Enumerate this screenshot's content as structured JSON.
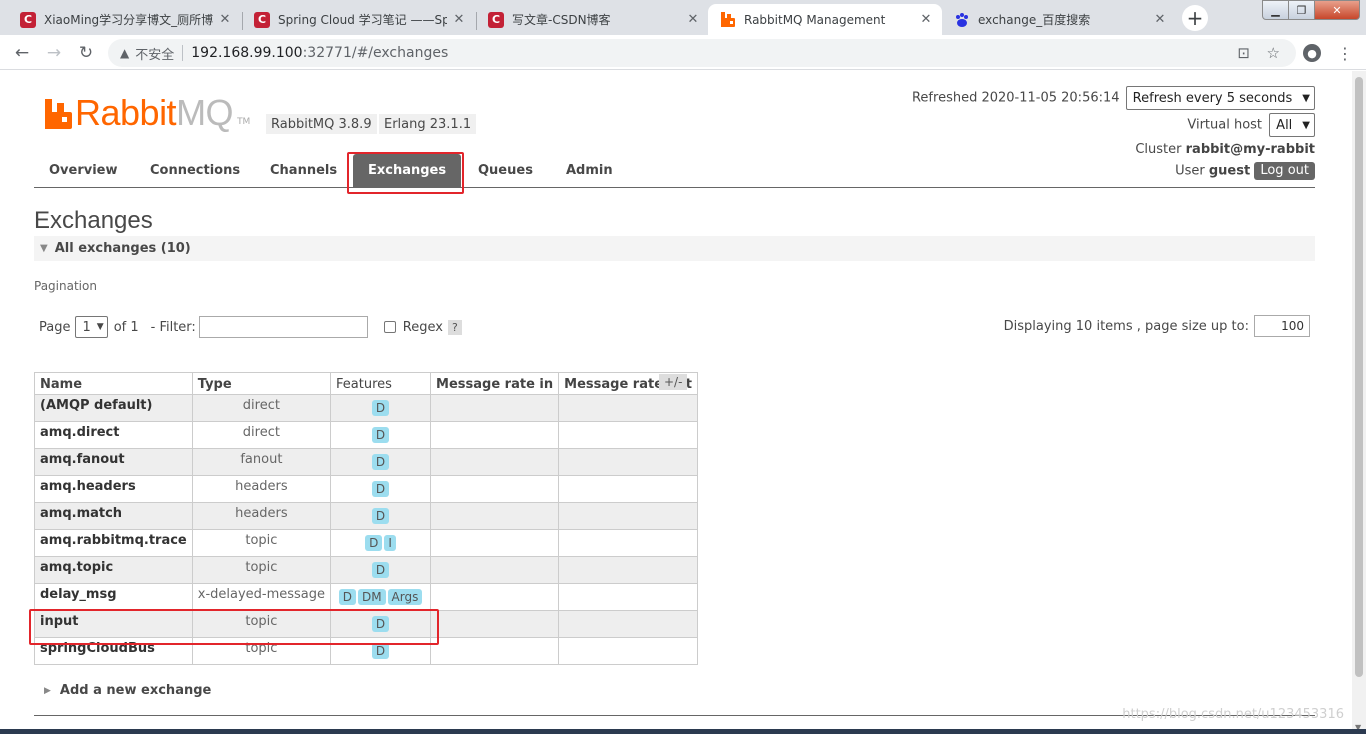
{
  "browser": {
    "tabs": [
      {
        "title": "XiaoMing学习分享博文_厕所博",
        "favicon": "csdn-icon",
        "active": false
      },
      {
        "title": "Spring Cloud 学习笔记 ——Sp",
        "favicon": "csdn-icon",
        "active": false
      },
      {
        "title": "写文章-CSDN博客",
        "favicon": "csdn-icon",
        "active": false
      },
      {
        "title": "RabbitMQ Management",
        "favicon": "rabbitmq-icon",
        "active": true
      },
      {
        "title": "exchange_百度搜索",
        "favicon": "baidu-icon",
        "active": false
      }
    ],
    "new_tab": "+",
    "address": {
      "warning": "不安全",
      "host": "192.168.99.100",
      "path": ":32771/#/exchanges"
    },
    "csdn_glyph": "C"
  },
  "header": {
    "logo_rabbit": "Rabbit",
    "logo_mq": "MQ",
    "logo_tm": "TM",
    "version": "RabbitMQ 3.8.9",
    "erlang": "Erlang 23.1.1",
    "refreshed_label": "Refreshed 2020-11-05 20:56:14",
    "refresh_select": "Refresh every 5 seconds",
    "vhost_label": "Virtual host",
    "vhost_select": "All",
    "cluster_label": "Cluster",
    "cluster_value": "rabbit@my-rabbit",
    "user_label": "User",
    "user_value": "guest",
    "logout": "Log out"
  },
  "nav": {
    "items": [
      "Overview",
      "Connections",
      "Channels",
      "Exchanges",
      "Queues",
      "Admin"
    ],
    "selected": "Exchanges"
  },
  "main": {
    "title": "Exchanges",
    "section": "All exchanges (10)",
    "pagination_label": "Pagination",
    "page_label": "Page",
    "page_select": "1",
    "of_label": "of 1",
    "filter_label": "- Filter:",
    "regex_label": "Regex",
    "help": "?",
    "displaying": "Displaying 10 items , page size up to:",
    "page_size": "100",
    "columns": [
      "Name",
      "Type",
      "Features",
      "Message rate in",
      "Message rate out"
    ],
    "plusminus": "+/-",
    "rows": [
      {
        "name": "(AMQP default)",
        "type": "direct",
        "features": [
          "D"
        ]
      },
      {
        "name": "amq.direct",
        "type": "direct",
        "features": [
          "D"
        ]
      },
      {
        "name": "amq.fanout",
        "type": "fanout",
        "features": [
          "D"
        ]
      },
      {
        "name": "amq.headers",
        "type": "headers",
        "features": [
          "D"
        ]
      },
      {
        "name": "amq.match",
        "type": "headers",
        "features": [
          "D"
        ]
      },
      {
        "name": "amq.rabbitmq.trace",
        "type": "topic",
        "features": [
          "D",
          "I"
        ]
      },
      {
        "name": "amq.topic",
        "type": "topic",
        "features": [
          "D"
        ]
      },
      {
        "name": "delay_msg",
        "type": "x-delayed-message",
        "features": [
          "D",
          "DM",
          "Args"
        ]
      },
      {
        "name": "input",
        "type": "topic",
        "features": [
          "D"
        ]
      },
      {
        "name": "springCloudBus",
        "type": "topic",
        "features": [
          "D"
        ]
      }
    ],
    "add_new": "Add a new exchange"
  },
  "watermark": "https://blog.csdn.net/u123453316",
  "colors": {
    "brand": "#ff6600",
    "nav_selected": "#666666",
    "feature_badge": "#9cddef",
    "highlight_box": "#e2252b"
  }
}
